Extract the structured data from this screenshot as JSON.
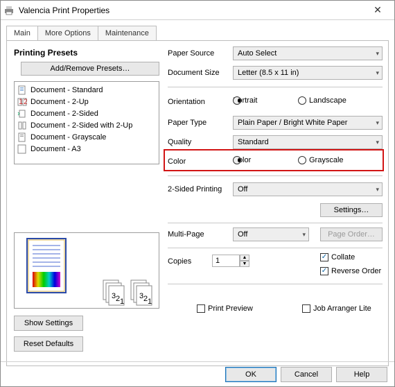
{
  "window_title": "Valencia Print Properties",
  "tabs": {
    "main": "Main",
    "more": "More Options",
    "maint": "Maintenance"
  },
  "presets": {
    "header": "Printing Presets",
    "addremove": "Add/Remove Presets…",
    "items": [
      "Document - Standard",
      "Document - 2-Up",
      "Document - 2-Sided",
      "Document - 2-Sided with 2-Up",
      "Document - Grayscale",
      "Document - A3"
    ]
  },
  "labels": {
    "paper_source": "Paper Source",
    "document_size": "Document Size",
    "orientation": "Orientation",
    "paper_type": "Paper Type",
    "quality": "Quality",
    "color": "Color",
    "twosided": "2-Sided Printing",
    "multipage": "Multi-Page",
    "copies": "Copies",
    "print_preview": "Print Preview",
    "job_arranger": "Job Arranger Lite",
    "show_settings": "Show Settings",
    "reset_defaults": "Reset Defaults"
  },
  "values": {
    "paper_source": "Auto Select",
    "document_size": "Letter (8.5 x 11 in)",
    "orientation_portrait": "Portrait",
    "orientation_landscape": "Landscape",
    "paper_type": "Plain Paper / Bright White Paper",
    "quality": "Standard",
    "color_color": "Color",
    "color_gray": "Grayscale",
    "twosided": "Off",
    "multipage": "Off",
    "copies": "1",
    "collate": "Collate",
    "reverse": "Reverse Order"
  },
  "buttons": {
    "settings": "Settings…",
    "page_order": "Page Order…",
    "ok": "OK",
    "cancel": "Cancel",
    "help": "Help"
  }
}
